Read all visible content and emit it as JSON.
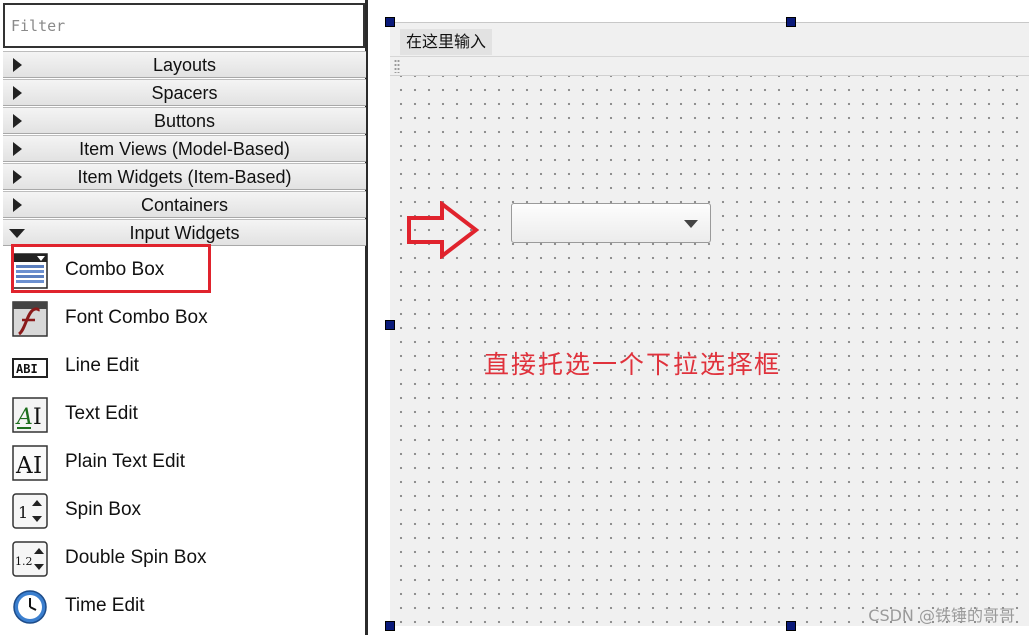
{
  "filter": {
    "placeholder": "Filter",
    "value": ""
  },
  "categories": [
    {
      "label": "Layouts",
      "expanded": false
    },
    {
      "label": "Spacers",
      "expanded": false
    },
    {
      "label": "Buttons",
      "expanded": false
    },
    {
      "label": "Item Views (Model-Based)",
      "expanded": false
    },
    {
      "label": "Item Widgets (Item-Based)",
      "expanded": false
    },
    {
      "label": "Containers",
      "expanded": false
    },
    {
      "label": "Input Widgets",
      "expanded": true
    }
  ],
  "input_widgets": [
    {
      "label": "Combo Box",
      "icon": "combo-box-icon"
    },
    {
      "label": "Font Combo Box",
      "icon": "font-combo-box-icon"
    },
    {
      "label": "Line Edit",
      "icon": "line-edit-icon"
    },
    {
      "label": "Text Edit",
      "icon": "text-edit-icon"
    },
    {
      "label": "Plain Text Edit",
      "icon": "plain-text-edit-icon"
    },
    {
      "label": "Spin Box",
      "icon": "spin-box-icon"
    },
    {
      "label": "Double Spin Box",
      "icon": "double-spin-box-icon"
    },
    {
      "label": "Time Edit",
      "icon": "time-edit-icon"
    }
  ],
  "form": {
    "menu_placeholder": "在这里输入",
    "annotation": "直接托选一个下拉选择框"
  },
  "colors": {
    "highlight": "#e0232d",
    "annotation": "#e0323c",
    "handle": "#0a1a7a"
  },
  "watermark": "CSDN @铁锤的哥哥"
}
